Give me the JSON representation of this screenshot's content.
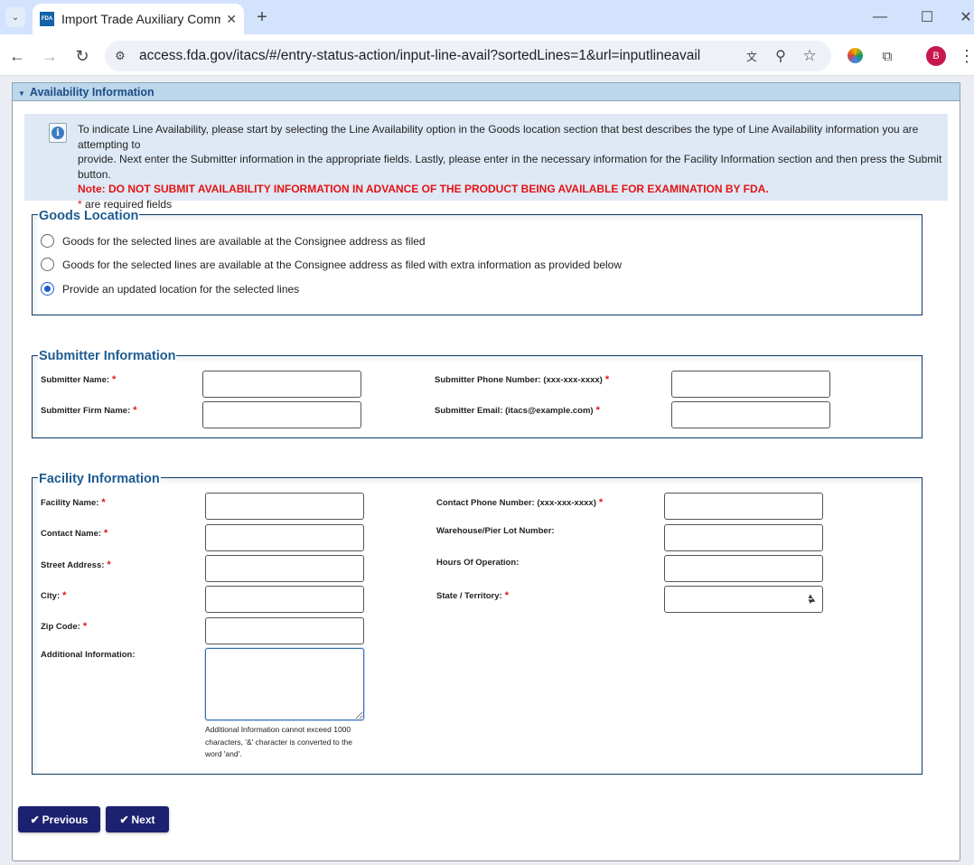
{
  "browser": {
    "tab_title": "Import Trade Auxiliary Comm",
    "favicon_text": "FDA",
    "url": "access.fda.gov/itacs/#/entry-status-action/input-line-avail?sortedLines=1&url=inputlineavail",
    "profile_initial": "B"
  },
  "panel": {
    "title": "Availability Information"
  },
  "info": {
    "line1": "To indicate Line Availability, please start by selecting the Line Availability option in the Goods location section that best describes the type of Line Availability information you are attempting to",
    "line2": "provide. Next enter the Submitter information in the appropriate fields. Lastly, please enter in the necessary information for the Facility Information section and then press the Submit button.",
    "note": "Note: DO NOT SUBMIT AVAILABILITY INFORMATION IN ADVANCE OF THE PRODUCT BEING AVAILABLE FOR EXAMINATION BY FDA.",
    "required_star": "*",
    "required_text": "are required fields"
  },
  "goods": {
    "legend": "Goods Location",
    "options": [
      {
        "label": "Goods for the selected lines are available at the Consignee address as filed",
        "selected": false
      },
      {
        "label": "Goods for the selected lines are available at the Consignee address as filed with extra information as provided below",
        "selected": false
      },
      {
        "label": "Provide an updated location for the selected lines",
        "selected": true
      }
    ]
  },
  "submitter": {
    "legend": "Submitter Information",
    "name": "Submitter Name:",
    "firm": "Submitter Firm Name:",
    "phone": "Submitter Phone Number:  (xxx-xxx-xxxx)",
    "email": "Submitter Email:  (itacs@example.com)"
  },
  "facility": {
    "legend": "Facility Information",
    "name": "Facility Name:",
    "contact": "Contact Name:",
    "street": "Street Address:",
    "city": "City:",
    "zip": "Zip Code:",
    "additional": "Additional Information:",
    "contact_phone": "Contact Phone Number: (xxx-xxx-xxxx)",
    "warehouse": "Warehouse/Pier Lot Number:",
    "hours": "Hours Of Operation:",
    "state": "State / Territory:",
    "state_value": "",
    "help": "Additional Information cannot exceed 1000 characters, '&' character is converted to the word 'and'."
  },
  "star": "*",
  "buttons": {
    "previous": "Previous",
    "next": "Next"
  }
}
